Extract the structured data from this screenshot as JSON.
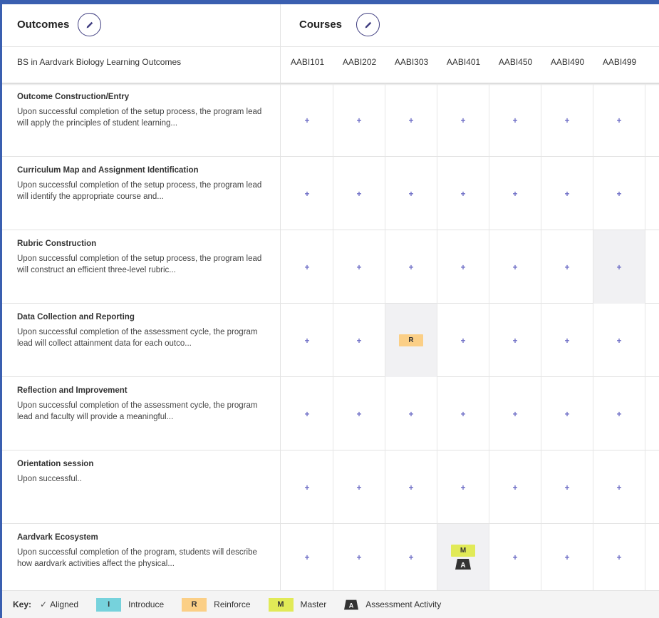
{
  "header": {
    "outcomes_title": "Outcomes",
    "courses_title": "Courses",
    "program_name": "BS in Aardvark Biology Learning Outcomes"
  },
  "courses": [
    "AABI101",
    "AABI202",
    "AABI303",
    "AABI401",
    "AABI450",
    "AABI490",
    "AABI499"
  ],
  "outcomes": [
    {
      "title": "Outcome Construction/Entry",
      "text": "Upon successful completion of the setup process, the program lead will apply the principles of student learning...",
      "cells": [
        "+",
        "+",
        "+",
        "+",
        "+",
        "+",
        "+"
      ]
    },
    {
      "title": "Curriculum Map and Assignment Identification",
      "text": "Upon successful completion of the setup process, the program lead will identify the appropriate course and...",
      "cells": [
        "+",
        "+",
        "+",
        "+",
        "+",
        "+",
        "+"
      ]
    },
    {
      "title": "Rubric Construction",
      "text": "Upon successful completion of the setup process, the program lead will construct an efficient three-level rubric...",
      "cells": [
        "+",
        "+",
        "+",
        "+",
        "+",
        "+",
        "+"
      ]
    },
    {
      "title": "Data Collection and Reporting",
      "text": "Upon successful completion of the assessment cycle, the program lead will collect attainment data for each outco...",
      "cells": [
        "+",
        "+",
        "R",
        "+",
        "+",
        "+",
        "+"
      ]
    },
    {
      "title": "Reflection and Improvement",
      "text": "Upon successful completion of the assessment cycle, the program lead and faculty will provide a meaningful...",
      "cells": [
        "+",
        "+",
        "+",
        "+",
        "+",
        "+",
        "+"
      ]
    },
    {
      "title": "Orientation session",
      "text": "Upon successful..",
      "cells": [
        "+",
        "+",
        "+",
        "+",
        "+",
        "+",
        "+"
      ]
    },
    {
      "title": "Aardvark Ecosystem",
      "text": "Upon successful completion of the program, students will describe how aardvark activities affect the physical...",
      "cells": [
        "+",
        "+",
        "+",
        "M+A",
        "+",
        "+",
        "+"
      ]
    }
  ],
  "key": {
    "label": "Key:",
    "aligned": "Aligned",
    "introduce_letter": "I",
    "introduce": "Introduce",
    "reinforce_letter": "R",
    "reinforce": "Reinforce",
    "master_letter": "M",
    "master": "Master",
    "assessment": "Assessment Activity"
  },
  "colors": {
    "accent": "#3f3d80",
    "plus": "#6c6cc6",
    "introduce": "#76d2dc",
    "reinforce": "#fbcf86",
    "master": "#e1ea57",
    "frame": "#3a5fb0"
  },
  "icons": {
    "edit": "pencil-icon",
    "aligned": "checkmark-icon",
    "assessment": "assessment-a-icon",
    "add": "plus-icon"
  }
}
